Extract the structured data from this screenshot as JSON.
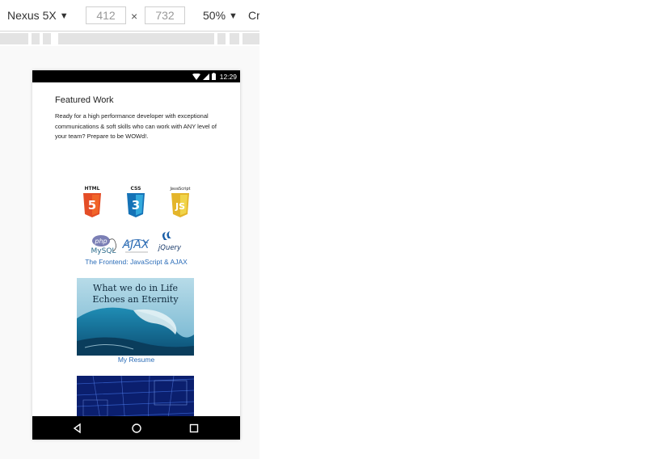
{
  "toolbar": {
    "device": "Nexus 5X",
    "width": "412",
    "height": "732",
    "times": "×",
    "zoom": "50%",
    "cut_label": "Cr"
  },
  "status": {
    "time": "12:29"
  },
  "page": {
    "heading": "Featured Work",
    "intro": "Ready for a high performance developer with exceptional communications & soft skills who can work with ANY level of your team? Prepare to be WOWd!.",
    "logos": {
      "html": "HTML",
      "html_num": "5",
      "css": "CSS",
      "css_num": "3",
      "js": "JavaScript",
      "js_num": "JS",
      "php": "php",
      "mysql": "MySQL",
      "ajax": "AJAX",
      "jquery": "jQuery"
    },
    "caption_frontend": "The Frontend: JavaScript & AJAX",
    "wave_text_1": "What we do in Life",
    "wave_text_2": "Echoes an Eternity",
    "caption_resume": "My Resume"
  }
}
